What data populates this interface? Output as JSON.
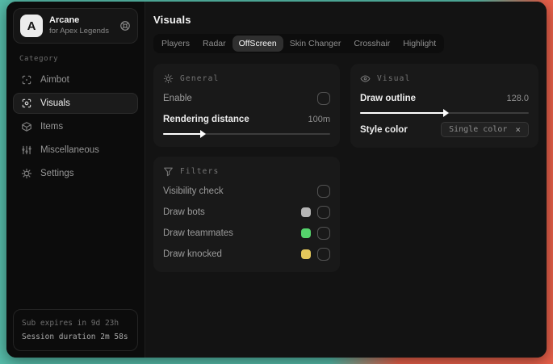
{
  "backdrop": {
    "teal": "#56bca9",
    "red": "#e8604a"
  },
  "sidebar": {
    "logo_letter": "A",
    "app_name": "Arcane",
    "app_subtitle": "for Apex Legends",
    "category_label": "Category",
    "items": [
      {
        "label": "Aimbot",
        "icon": "crosshair-scan-icon",
        "selected": false
      },
      {
        "label": "Visuals",
        "icon": "eye-scan-icon",
        "selected": true
      },
      {
        "label": "Items",
        "icon": "cube-icon",
        "selected": false
      },
      {
        "label": "Miscellaneous",
        "icon": "sliders-icon",
        "selected": false
      },
      {
        "label": "Settings",
        "icon": "gear-icon",
        "selected": false
      }
    ],
    "footer": {
      "sub_expires": "Sub expires in 9d 23h",
      "session_duration": "Session duration 2m 58s"
    }
  },
  "main": {
    "title": "Visuals",
    "selected_tab": "OffScreen",
    "tabs": [
      {
        "label": "Players"
      },
      {
        "label": "Radar"
      },
      {
        "label": "OffScreen"
      },
      {
        "label": "Skin Changer"
      },
      {
        "label": "Crosshair"
      },
      {
        "label": "Highlight"
      }
    ],
    "general": {
      "title": "General",
      "enable_label": "Enable",
      "enable_checked": false,
      "distance_label": "Rendering distance",
      "distance_value": "100m",
      "slider_fill": "23%"
    },
    "visual": {
      "title": "Visual",
      "outline_label": "Draw outline",
      "outline_value": "128.0",
      "slider_fill": "50%",
      "style_color_label": "Style color",
      "style_color_value": "Single color",
      "clear_glyph": "×"
    },
    "filters": {
      "title": "Filters",
      "rows": [
        {
          "label": "Visibility check",
          "swatch": null,
          "checked": false
        },
        {
          "label": "Draw bots",
          "swatch": "#b5b5b5",
          "checked": false
        },
        {
          "label": "Draw teammates",
          "swatch": "#55d36c",
          "checked": false
        },
        {
          "label": "Draw knocked",
          "swatch": "#e4c75b",
          "checked": false
        }
      ]
    }
  }
}
